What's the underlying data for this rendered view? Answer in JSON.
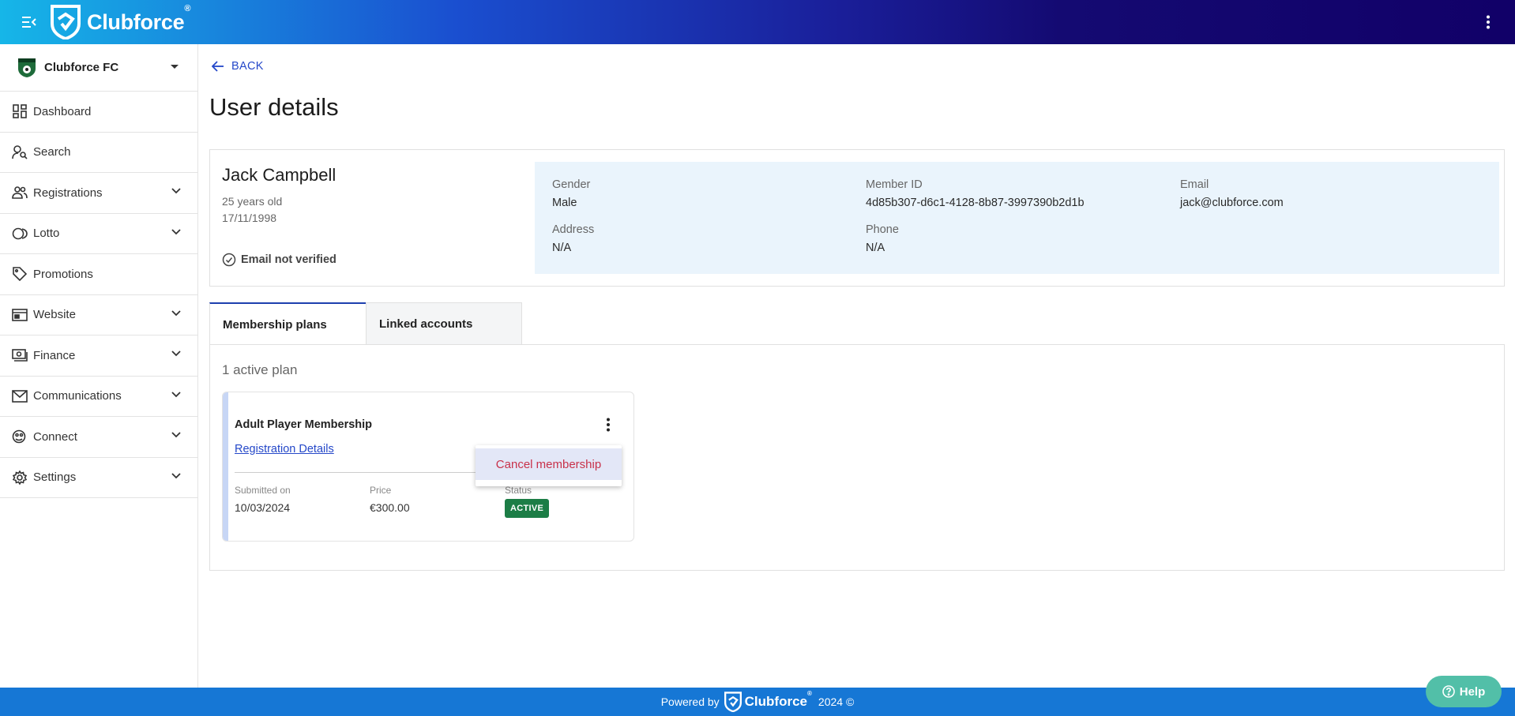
{
  "brand": {
    "name": "Clubforce",
    "reg": "®"
  },
  "sidebar": {
    "club_name": "Clubforce FC",
    "items": [
      {
        "label": "Dashboard",
        "icon": "dashboard-icon",
        "expandable": false
      },
      {
        "label": "Search",
        "icon": "person-search-icon",
        "expandable": false
      },
      {
        "label": "Registrations",
        "icon": "people-icon",
        "expandable": true
      },
      {
        "label": "Lotto",
        "icon": "lotto-icon",
        "expandable": true
      },
      {
        "label": "Promotions",
        "icon": "tag-icon",
        "expandable": false
      },
      {
        "label": "Website",
        "icon": "website-icon",
        "expandable": true
      },
      {
        "label": "Finance",
        "icon": "finance-icon",
        "expandable": true
      },
      {
        "label": "Communications",
        "icon": "mail-icon",
        "expandable": true
      },
      {
        "label": "Connect",
        "icon": "connect-icon",
        "expandable": true
      },
      {
        "label": "Settings",
        "icon": "gear-icon",
        "expandable": true
      }
    ]
  },
  "main": {
    "back_label": "BACK",
    "title": "User details",
    "user": {
      "name": "Jack Campbell",
      "age": "25 years old",
      "dob": "17/11/1998",
      "email_status": "Email not verified",
      "gender_label": "Gender",
      "gender": "Male",
      "member_id_label": "Member ID",
      "member_id": "4d85b307-d6c1-4128-8b87-3997390b2d1b",
      "email_label": "Email",
      "email": "jack@clubforce.com",
      "address_label": "Address",
      "address": "N/A",
      "phone_label": "Phone",
      "phone": "N/A"
    },
    "tabs": [
      {
        "label": "Membership plans",
        "active": true
      },
      {
        "label": "Linked accounts",
        "active": false
      }
    ],
    "plans": {
      "count_label": "1 active plan",
      "items": [
        {
          "name": "Adult Player Membership",
          "link": "Registration Details",
          "submitted_label": "Submitted on",
          "submitted": "10/03/2024",
          "price_label": "Price",
          "price": "€300.00",
          "status_label": "Status",
          "status": "ACTIVE"
        }
      ]
    },
    "menu": {
      "cancel_label": "Cancel membership"
    }
  },
  "footer": {
    "powered_by": "Powered by",
    "brand": "Clubforce",
    "reg": "®",
    "year": "2024 ©"
  },
  "help": {
    "label": "Help"
  },
  "colors": {
    "accent": "#2548c9",
    "footer": "#1677d5",
    "active_badge": "#1c7d46",
    "danger": "#c8314a",
    "help": "#52bfa8"
  }
}
